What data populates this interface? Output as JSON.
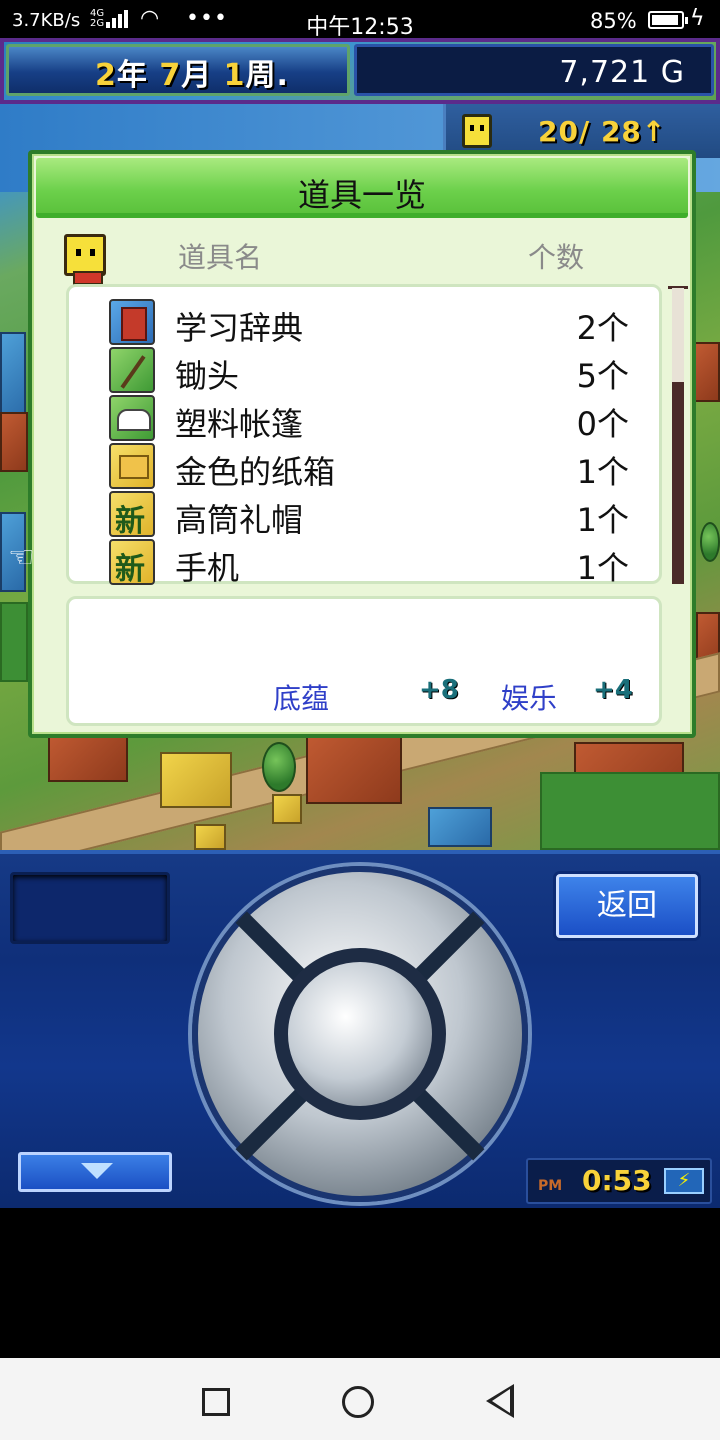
{
  "status_bar": {
    "net_speed": "3.7KB/s",
    "signal_type": "4G 2G",
    "dots": "•••",
    "clock": "中午12:53",
    "battery": "85%"
  },
  "hud": {
    "year": "2",
    "year_unit": "年",
    "month": "7",
    "month_unit": "月",
    "week": "1",
    "week_unit": "周.",
    "money": "7,721 G",
    "counter": "20/ 28↑"
  },
  "dialog": {
    "title": "道具一览",
    "col_name": "道具名",
    "col_count": "个数",
    "items": [
      {
        "name": "学习辞典",
        "count": "2个",
        "icon": "book-icon"
      },
      {
        "name": "锄头",
        "count": "5个",
        "icon": "hoe-icon"
      },
      {
        "name": "塑料帐篷",
        "count": "0个",
        "icon": "tent-icon"
      },
      {
        "name": "金色的纸箱",
        "count": "1个",
        "icon": "box-icon"
      },
      {
        "name": "高筒礼帽",
        "count": "1个",
        "icon": "new-badge-icon"
      },
      {
        "name": "手机",
        "count": "1个",
        "icon": "new-badge-icon"
      }
    ],
    "stats": [
      {
        "label": "底蕴",
        "value": "+8"
      },
      {
        "label": "娱乐",
        "value": "+4"
      }
    ],
    "scroll_position": 0.35
  },
  "controller": {
    "back_label": "返回",
    "clock_ampm": "PM",
    "clock_time": "0:53",
    "battery_glyph": "⚡"
  },
  "colors": {
    "dialog_green": "#6cd04b",
    "controller_blue": "#12378c",
    "hud_yellow": "#f8d23a",
    "stat_label_blue": "#2f3fc8"
  }
}
